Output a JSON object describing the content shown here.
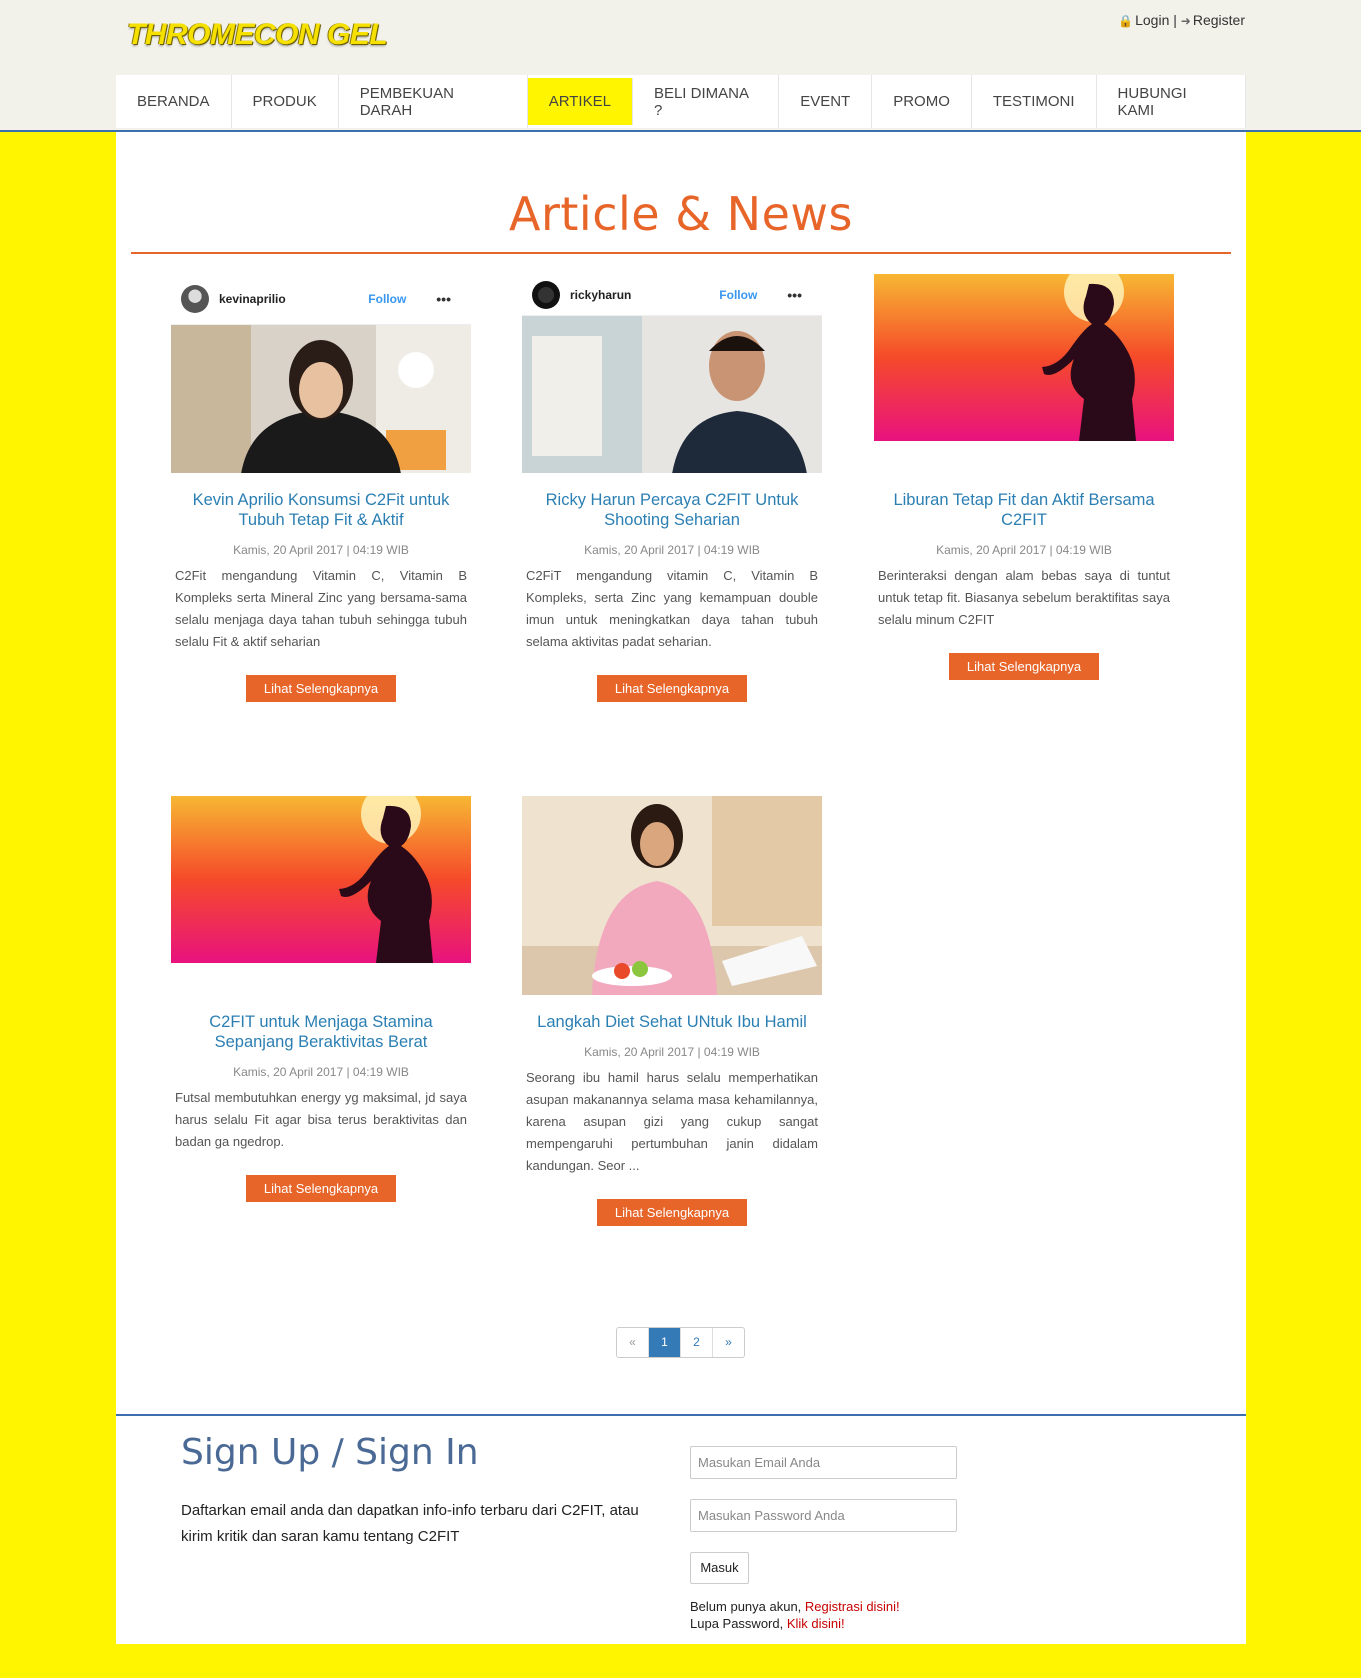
{
  "header": {
    "logo": "THROMECON GEL",
    "login": "Login",
    "separator": "|",
    "register": "Register"
  },
  "nav": {
    "items": [
      "BERANDA",
      "PRODUK",
      "PEMBEKUAN DARAH",
      "ARTIKEL",
      "BELI DIMANA ?",
      "EVENT",
      "PROMO",
      "TESTIMONI",
      "HUBUNGI KAMI"
    ],
    "active": "ARTIKEL"
  },
  "page": {
    "title": "Article & News"
  },
  "articles": [
    {
      "ig_user": "kevinaprilio",
      "ig_follow": "Follow",
      "ig_more": "•••",
      "title": "Kevin Aprilio Konsumsi C2Fit untuk Tubuh Tetap Fit & Aktif",
      "date": "Kamis, 20 April 2017 | 04:19 WIB",
      "excerpt": "C2Fit mengandung Vitamin C, Vitamin B Kompleks serta Mineral Zinc yang bersama-sama selalu menjaga daya tahan tubuh sehingga tubuh selalu Fit & aktif seharian",
      "button": "Lihat Selengkapnya"
    },
    {
      "ig_user": "rickyharun",
      "ig_follow": "Follow",
      "ig_more": "•••",
      "title": "Ricky Harun Percaya C2FIT Untuk Shooting Seharian",
      "date": "Kamis, 20 April 2017 | 04:19 WIB",
      "excerpt": "C2FiT mengandung vitamin C, Vitamin B Kompleks, serta Zinc yang kemampuan double imun untuk meningkatkan daya tahan tubuh selama aktivitas padat seharian.",
      "button": "Lihat Selengkapnya"
    },
    {
      "title": "Liburan Tetap Fit dan Aktif Bersama C2FIT",
      "date": "Kamis, 20 April 2017 | 04:19 WIB",
      "excerpt": "Berinteraksi dengan alam bebas saya di tuntut untuk tetap fit. Biasanya sebelum beraktifitas saya selalu minum C2FIT",
      "button": "Lihat Selengkapnya"
    },
    {
      "title": "C2FIT untuk Menjaga Stamina Sepanjang Beraktivitas Berat",
      "date": "Kamis, 20 April 2017 | 04:19 WIB",
      "excerpt": "Futsal membutuhkan energy yg maksimal, jd saya harus selalu Fit agar bisa terus beraktivitas dan badan ga ngedrop.",
      "button": "Lihat Selengkapnya"
    },
    {
      "title": "Langkah Diet Sehat UNtuk Ibu Hamil",
      "date": "Kamis, 20 April 2017 | 04:19 WIB",
      "excerpt": "Seorang ibu hamil harus selalu memperhatikan asupan makanannya selama masa kehamilannya, karena asupan gizi yang cukup sangat mempengaruhi pertumbuhan janin didalam kandungan. Seor ...",
      "button": "Lihat Selengkapnya"
    }
  ],
  "pagination": {
    "prev": "«",
    "pages": [
      "1",
      "2"
    ],
    "current": "1",
    "next": "»"
  },
  "signup": {
    "title": "Sign Up / Sign In",
    "text": "Daftarkan email anda dan dapatkan info-info terbaru dari C2FIT, atau kirim kritik dan saran kamu tentang C2FIT",
    "email_placeholder": "Masukan Email Anda",
    "password_placeholder": "Masukan Password Anda",
    "submit": "Masuk",
    "no_account": "Belum punya akun,",
    "register_link": "Registrasi disini!",
    "forgot": "Lupa Password,",
    "forgot_link": "Klik disini!"
  },
  "colors": {
    "accent": "#e8652a",
    "link": "#2b7fb3",
    "background": "#fff500",
    "border": "#3b6fb0"
  }
}
